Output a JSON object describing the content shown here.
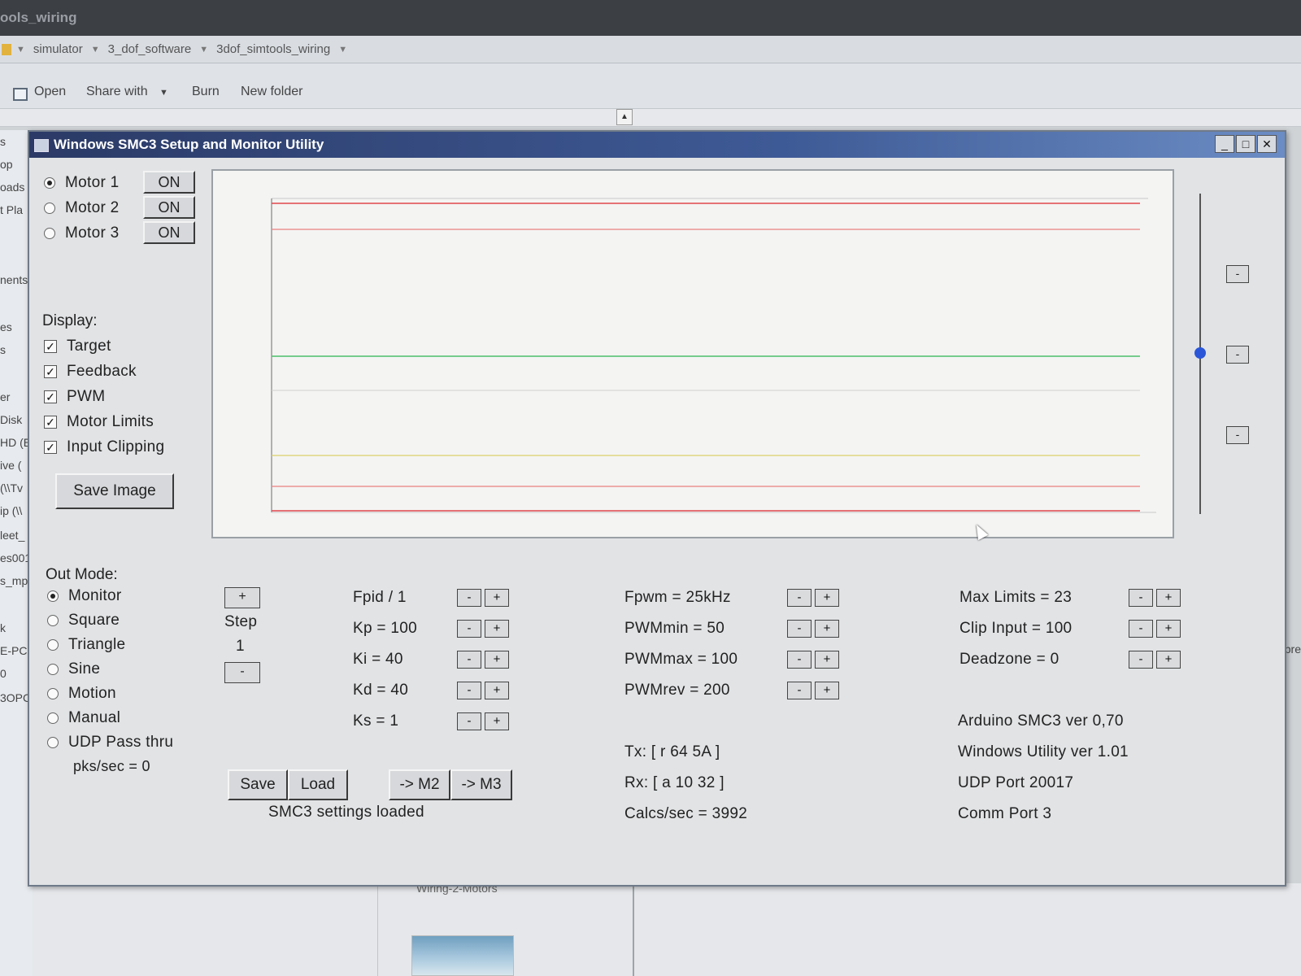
{
  "explorer": {
    "title": "ools_wiring",
    "breadcrumbs": [
      "simulator",
      "3_dof_software",
      "3dof_simtools_wiring"
    ],
    "toolbar": {
      "open": "Open",
      "share_with": "Share with",
      "burn": "Burn",
      "new_folder": "New folder"
    },
    "nav_items": [
      "s",
      "op",
      "oads",
      "t Pla",
      "nents",
      "es",
      "s",
      "er",
      "Disk",
      "HD (E",
      "ive (",
      "(\\\\Tv",
      "ip (\\\\",
      "leet_",
      "es001",
      "s_mp",
      "k",
      "E-PC",
      "0",
      "3OPC"
    ],
    "right_edge_text": "pre",
    "thumbnail_label": "Wiring-2-Motors"
  },
  "window": {
    "title": "Windows SMC3 Setup and Monitor Utility",
    "minimize": "_",
    "maximize": "□",
    "close": "✕"
  },
  "motors": [
    {
      "label": "Motor 1",
      "selected": true,
      "button": "ON"
    },
    {
      "label": "Motor 2",
      "selected": false,
      "button": "ON"
    },
    {
      "label": "Motor 3",
      "selected": false,
      "button": "ON"
    }
  ],
  "display": {
    "heading": "Display:",
    "options": [
      {
        "label": "Target",
        "checked": true
      },
      {
        "label": "Feedback",
        "checked": true
      },
      {
        "label": "PWM",
        "checked": true
      },
      {
        "label": "Motor Limits",
        "checked": true
      },
      {
        "label": "Input Clipping",
        "checked": true
      }
    ],
    "save_image": "Save Image"
  },
  "plot": {
    "line_colors": {
      "limit": "#e0474c",
      "clip": "#ea8080",
      "feedback": "#4cbf6a",
      "pwm": "#dccf6a",
      "center": "#cfcfcf"
    }
  },
  "slider": {
    "buttons": [
      "-",
      "-",
      "-"
    ]
  },
  "out_mode": {
    "heading": "Out Mode:",
    "options": [
      {
        "label": "Monitor",
        "selected": true
      },
      {
        "label": "Square",
        "selected": false
      },
      {
        "label": "Triangle",
        "selected": false
      },
      {
        "label": "Sine",
        "selected": false
      },
      {
        "label": "Motion",
        "selected": false
      },
      {
        "label": "Manual",
        "selected": false
      },
      {
        "label": "UDP Pass thru",
        "selected": false
      }
    ],
    "pks_sec": "pks/sec = 0"
  },
  "step": {
    "plus": "+",
    "label": "Step",
    "value": "1",
    "minus": "-"
  },
  "pid": {
    "items": [
      "Fpid / 1",
      "Kp = 100",
      "Ki = 40",
      "Kd = 40",
      "Ks = 1"
    ],
    "minus": "-",
    "plus": "+"
  },
  "pwm": {
    "items": [
      "Fpwm = 25kHz",
      "PWMmin = 50",
      "PWMmax = 100",
      "PWMrev = 200"
    ],
    "minus": "-",
    "plus": "+"
  },
  "limits": {
    "items": [
      "Max Limits = 23",
      "Clip Input = 100",
      "Deadzone = 0"
    ],
    "minus": "-",
    "plus": "+"
  },
  "actions": {
    "save": "Save",
    "load": "Load",
    "to_m2": "-> M2",
    "to_m3": "-> M3",
    "status": "SMC3 settings loaded"
  },
  "comm": {
    "tx": "Tx: [ r 64 5A ]",
    "rx": "Rx: [ a 10 32 ]",
    "calcs": "Calcs/sec = 3992"
  },
  "info": {
    "arduino": "Arduino SMC3 ver 0,70",
    "utility": "Windows Utility ver 1.01",
    "udp": "UDP Port 20017",
    "comm_port": "Comm Port 3"
  }
}
